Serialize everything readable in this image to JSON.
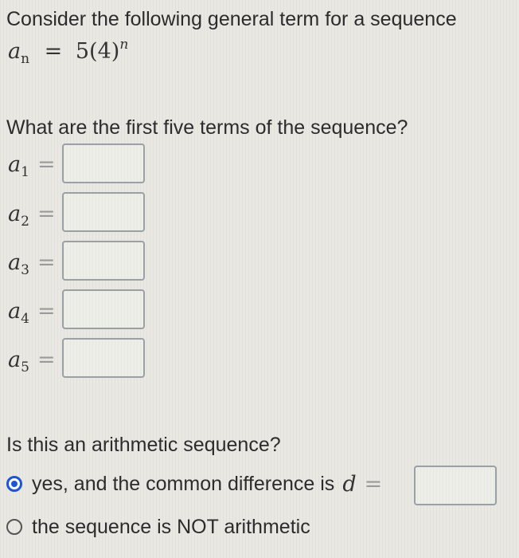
{
  "prompt": "Consider the following general term for a sequence",
  "formula": {
    "symbol": "a",
    "subscript": "n",
    "equals": "=",
    "rhs": "5(4)",
    "exponent": "n"
  },
  "terms_question": "What are the first five terms of the sequence?",
  "terms": [
    {
      "symbol": "a",
      "subscript": "1",
      "equals": "=",
      "value": ""
    },
    {
      "symbol": "a",
      "subscript": "2",
      "equals": "=",
      "value": ""
    },
    {
      "symbol": "a",
      "subscript": "3",
      "equals": "=",
      "value": ""
    },
    {
      "symbol": "a",
      "subscript": "4",
      "equals": "=",
      "value": ""
    },
    {
      "symbol": "a",
      "subscript": "5",
      "equals": "=",
      "value": ""
    }
  ],
  "arithmetic_question": "Is this an arithmetic sequence?",
  "options": [
    {
      "label": "yes, and the common difference is",
      "variable": "d",
      "equals": "=",
      "value": "",
      "selected": true
    },
    {
      "label": "the sequence is NOT arithmetic",
      "selected": false
    }
  ],
  "colors": {
    "accent": "#1a56d6",
    "background": "#e9e8e2",
    "text": "#2c2c2c"
  }
}
